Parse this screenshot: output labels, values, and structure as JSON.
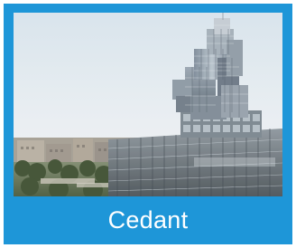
{
  "tile": {
    "caption": "Cedant",
    "background_color": "#1e96d8",
    "caption_color": "#ffffff"
  },
  "photo": {
    "subject": "building-photo-icon"
  }
}
